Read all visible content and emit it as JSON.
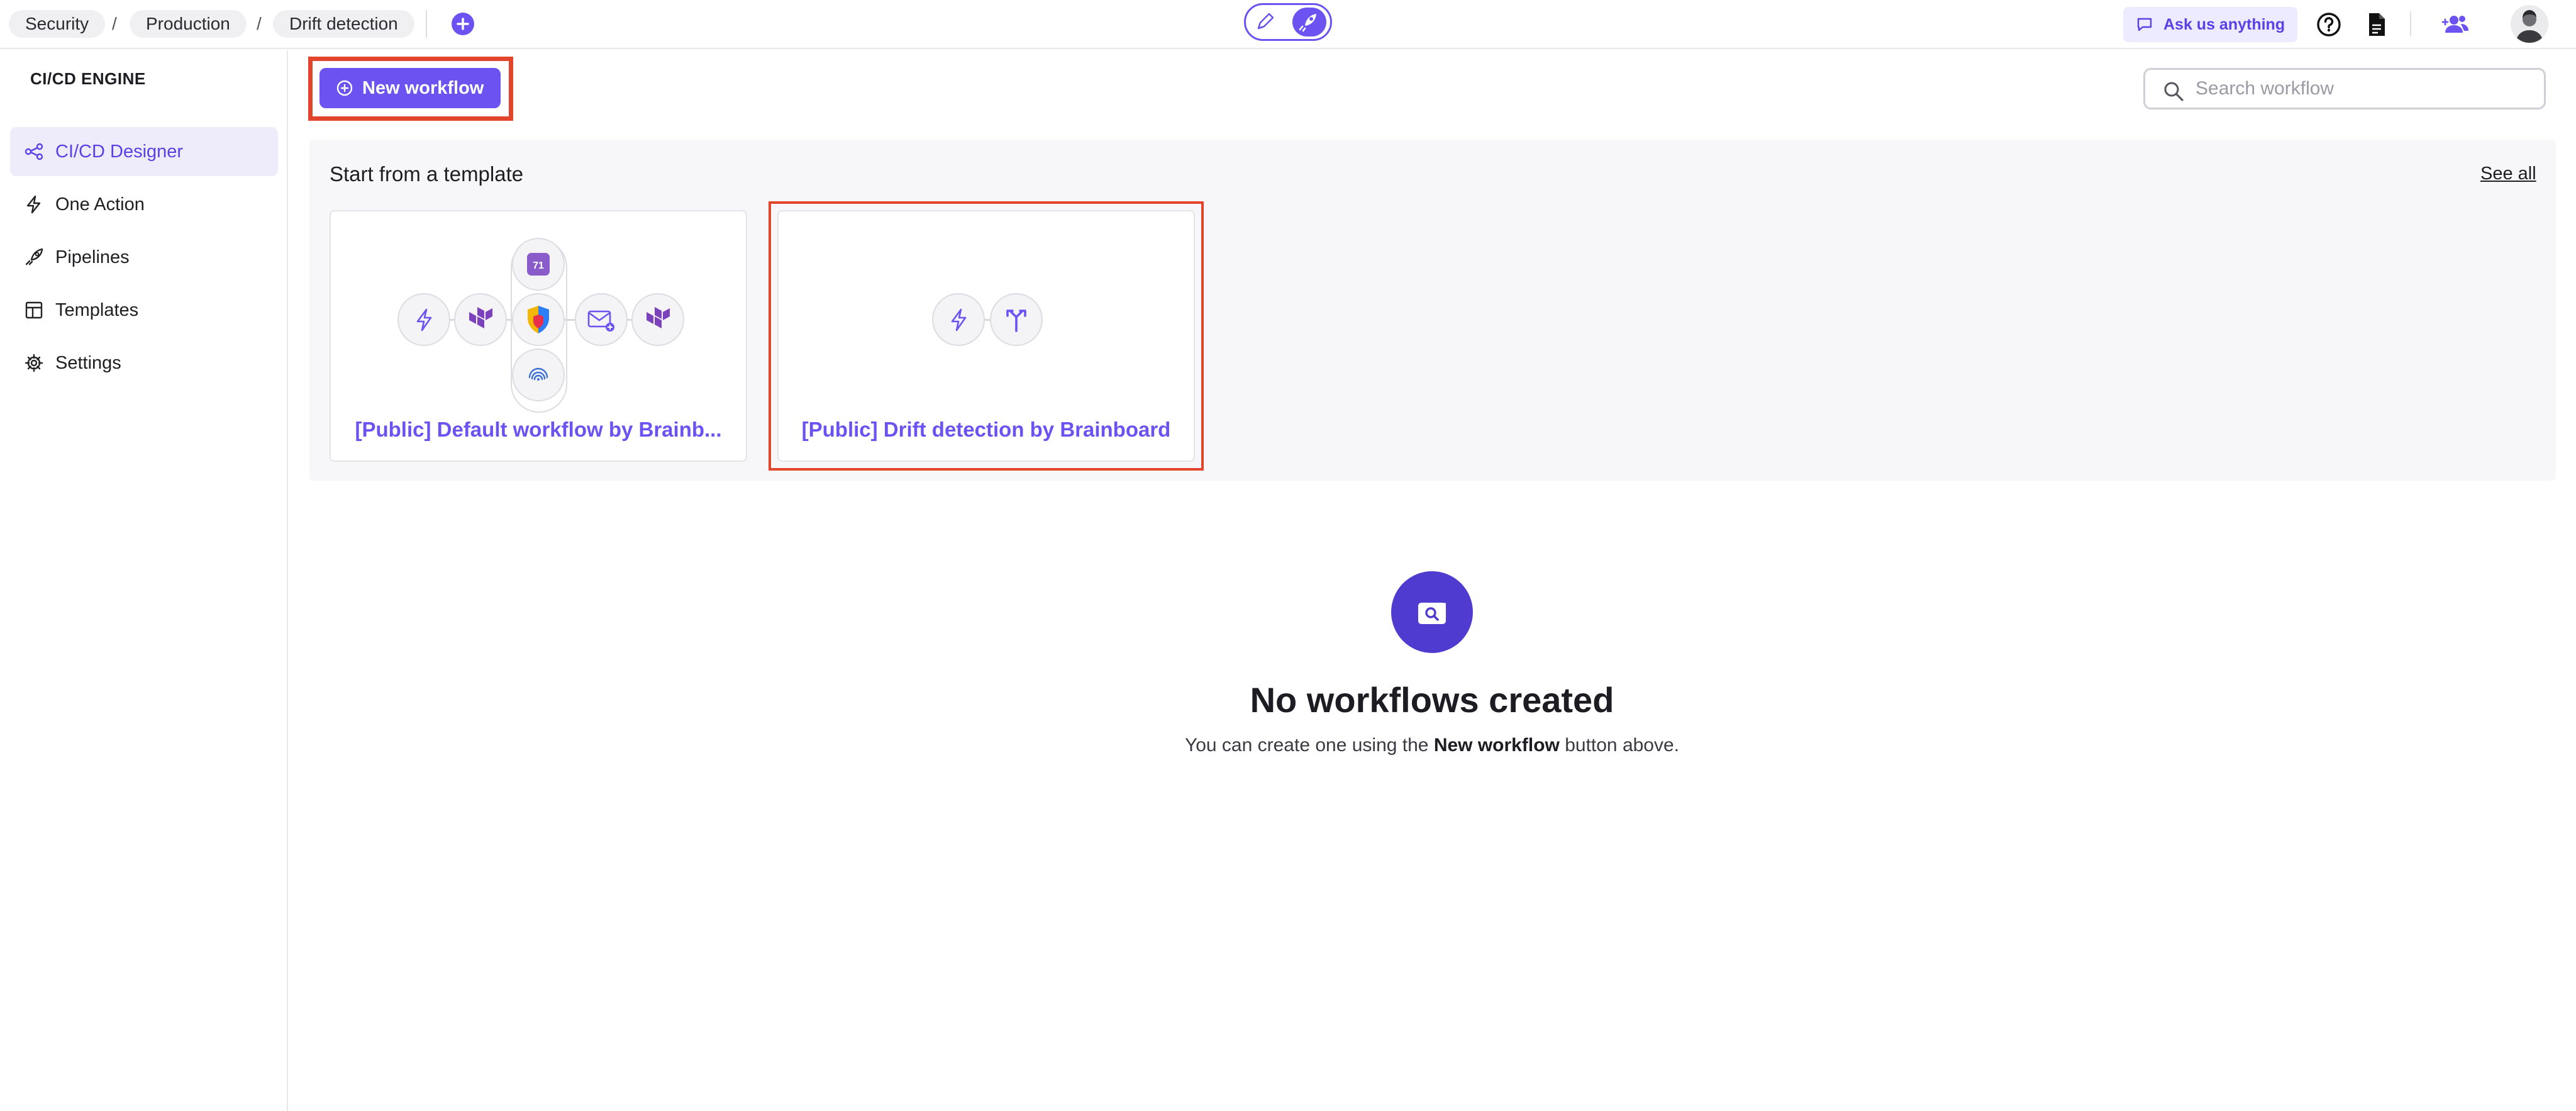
{
  "breadcrumb": {
    "items": [
      "Security",
      "Production",
      "Drift detection"
    ],
    "separator": "/"
  },
  "topbar": {
    "ask_label": "Ask us anything",
    "mode_toggle": {
      "left_icon": "pencil-icon",
      "right_icon": "rocket-icon",
      "active": "right"
    },
    "icons": [
      "help-icon",
      "document-icon",
      "team-icon",
      "avatar"
    ]
  },
  "sidebar": {
    "title": "CI/CD ENGINE",
    "items": [
      {
        "label": "CI/CD Designer",
        "icon": "workflow-icon",
        "active": true
      },
      {
        "label": "One Action",
        "icon": "bolt-icon",
        "active": false
      },
      {
        "label": "Pipelines",
        "icon": "rocket-icon",
        "active": false
      },
      {
        "label": "Templates",
        "icon": "templates-icon",
        "active": false
      },
      {
        "label": "Settings",
        "icon": "gear-icon",
        "active": false
      }
    ]
  },
  "main": {
    "new_workflow_label": "New workflow",
    "search_placeholder": "Search workflow",
    "templates": {
      "title": "Start from a template",
      "see_all": "See all",
      "cards": [
        {
          "label": "[Public] Default workflow by Brainb...",
          "highlighted": false
        },
        {
          "label": "[Public] Drift detection by Brainboard",
          "highlighted": true
        }
      ]
    },
    "empty_state": {
      "title": "No workflows created",
      "subtitle_prefix": "You can create one using the ",
      "subtitle_bold": "New workflow",
      "subtitle_suffix": " button above."
    }
  },
  "colors": {
    "accent": "#6c52f0",
    "highlight_frame": "#e2452b",
    "empty_icon_bg": "#4f3bd0"
  }
}
